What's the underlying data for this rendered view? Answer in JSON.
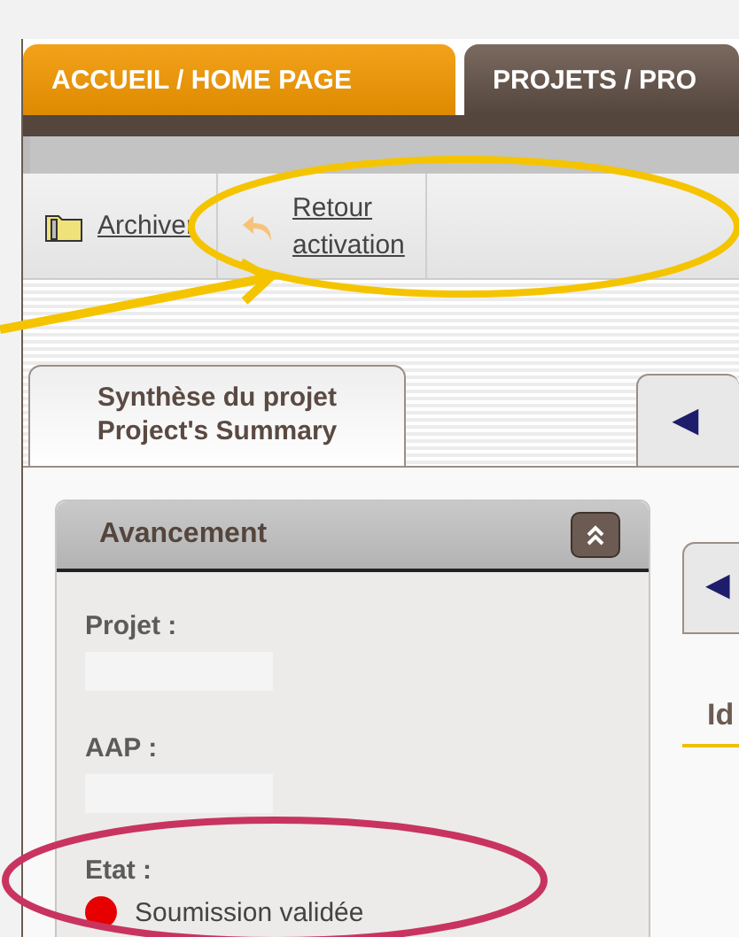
{
  "top_tabs": [
    {
      "label": "ACCUEIL / HOME PAGE",
      "selected": false
    },
    {
      "label": "PROJETS / PRO",
      "selected": true
    }
  ],
  "toolbar": [
    {
      "label": "Archiver",
      "kind": "archive"
    },
    {
      "label": "Retour activation",
      "kind": "return"
    }
  ],
  "project_tabs": [
    {
      "label": "Synthèse du projet\nProject's Summary",
      "selected": true
    },
    {
      "label": "◀",
      "selected": false
    }
  ],
  "panel": {
    "title": "Avancement",
    "expanded": true,
    "fields": [
      {
        "label": "Projet :",
        "kind": "hidden"
      },
      {
        "label": "AAP :",
        "kind": "hidden"
      },
      {
        "label": "Etat :",
        "kind": "status",
        "status": "Soumission validée",
        "color": "#e60000"
      }
    ]
  },
  "side": {
    "arrow": "◀",
    "heading": "Id"
  }
}
